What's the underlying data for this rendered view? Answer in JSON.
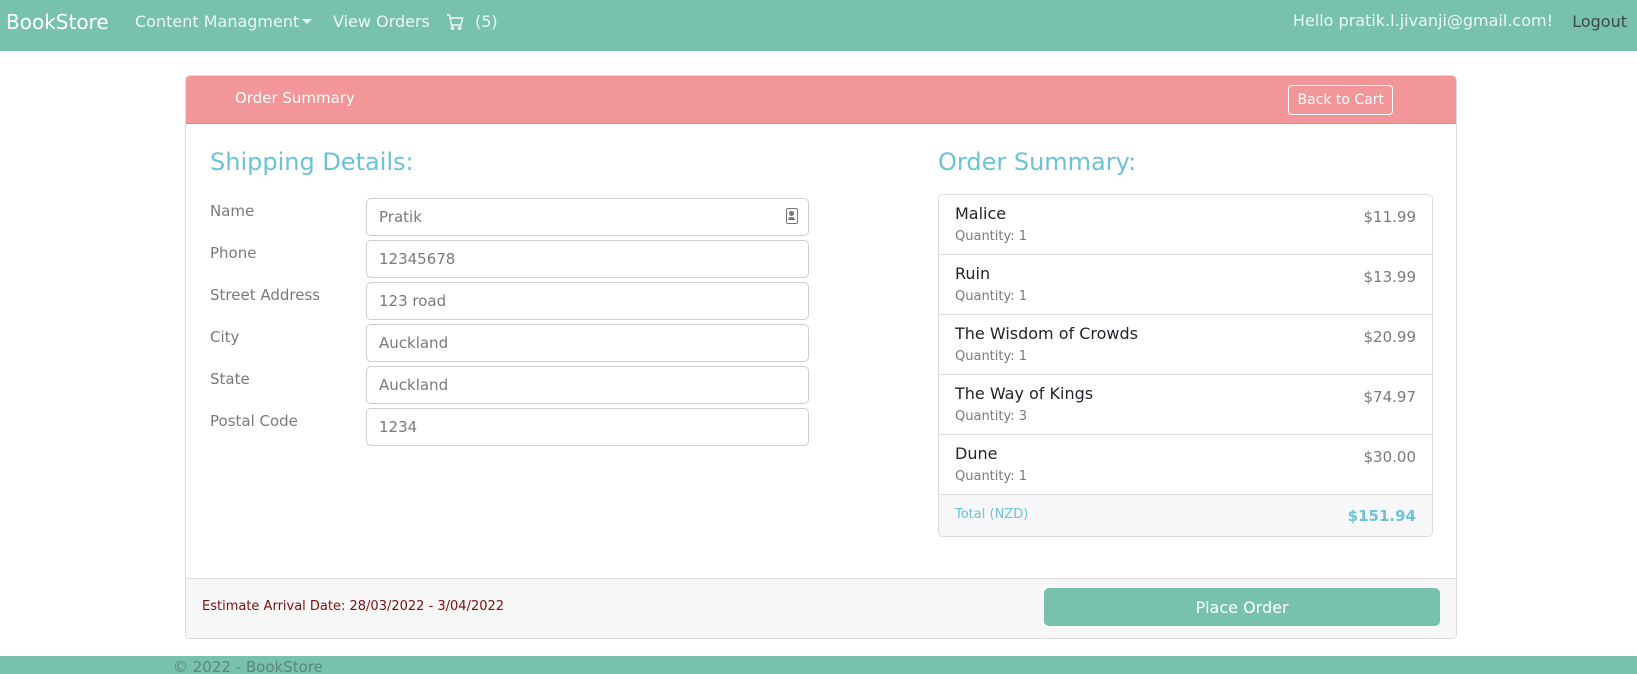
{
  "navbar": {
    "brand": "BookStore",
    "content_management": "Content Managment",
    "view_orders": "View Orders",
    "cart_count": "(5)",
    "greeting": "Hello pratik.l.jivanji@gmail.com!",
    "logout": "Logout",
    "icons": {
      "cart": "cart-icon",
      "dropdown": "chevron-down-icon"
    }
  },
  "card": {
    "header_title": "Order Summary",
    "back_button": "Back to Cart"
  },
  "shipping": {
    "title": "Shipping Details:",
    "fields": [
      {
        "label": "Name",
        "value": "Pratik"
      },
      {
        "label": "Phone",
        "value": "12345678"
      },
      {
        "label": "Street Address",
        "value": "123 road"
      },
      {
        "label": "City",
        "value": "Auckland"
      },
      {
        "label": "State",
        "value": "Auckland"
      },
      {
        "label": "Postal Code",
        "value": "1234"
      }
    ]
  },
  "summary": {
    "title": "Order Summary:",
    "items": [
      {
        "title": "Malice",
        "quantity": "Quantity: 1",
        "price": "$11.99"
      },
      {
        "title": "Ruin",
        "quantity": "Quantity: 1",
        "price": "$13.99"
      },
      {
        "title": "The Wisdom of Crowds",
        "quantity": "Quantity: 1",
        "price": "$20.99"
      },
      {
        "title": "The Way of Kings",
        "quantity": "Quantity: 3",
        "price": "$74.97"
      },
      {
        "title": "Dune",
        "quantity": "Quantity: 1",
        "price": "$30.00"
      }
    ],
    "total_label": "Total (NZD)",
    "total_value": "$151.94"
  },
  "footer_card": {
    "arrival": "Estimate Arrival Date: 28/03/2022 - 3/04/2022",
    "place_order": "Place Order"
  },
  "page_footer": {
    "copyright": "© 2022 - BookStore"
  },
  "colors": {
    "primary": "#78c2ad",
    "header": "#f3969a",
    "info": "#6cc3d5",
    "arrival_text": "#7b1010"
  }
}
